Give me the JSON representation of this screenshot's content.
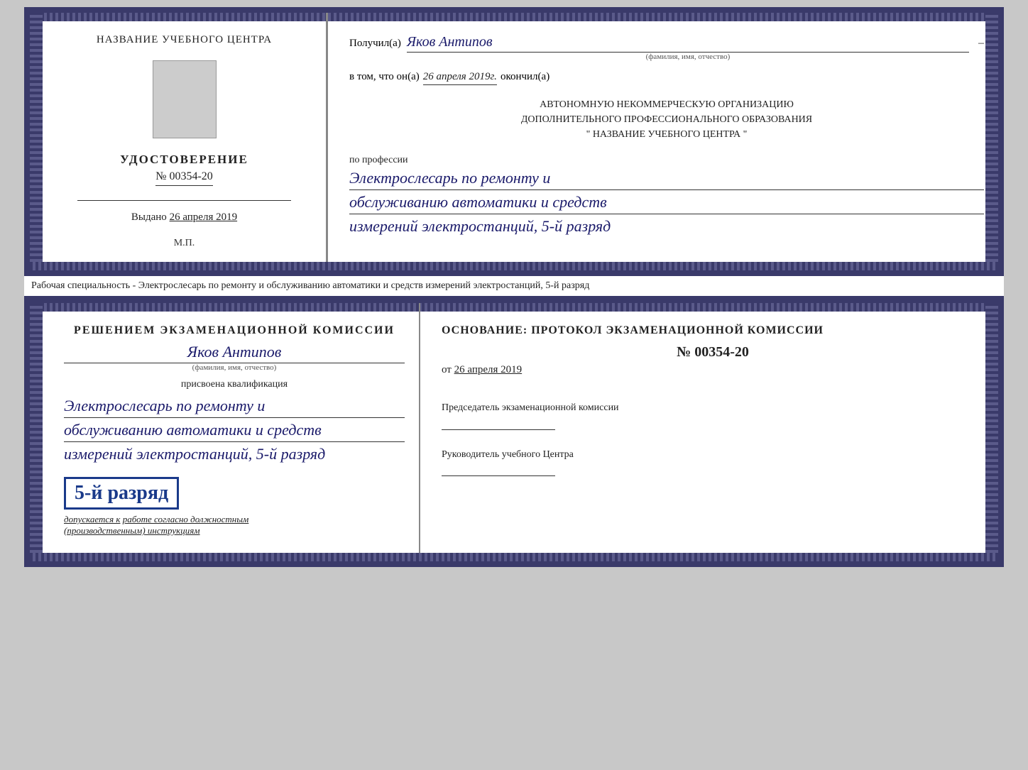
{
  "topCert": {
    "left": {
      "orgName": "НАЗВАНИЕ УЧЕБНОГО ЦЕНТРА",
      "certTitle": "УДОСТОВЕРЕНИЕ",
      "certNumber": "№ 00354-20",
      "issuedLabel": "Выдано",
      "issuedDate": "26 апреля 2019",
      "stamp": "М.П."
    },
    "right": {
      "receivedLabel": "Получил(а)",
      "recipientName": "Яков Антипов",
      "recipientSublabel": "(фамилия, имя, отчество)",
      "certifyLabel": "в том, что он(а)",
      "certifyDate": "26 апреля 2019г.",
      "finishedLabel": "окончил(а)",
      "orgFullLine1": "АВТОНОМНУЮ НЕКОММЕРЧЕСКУЮ ОРГАНИЗАЦИЮ",
      "orgFullLine2": "ДОПОЛНИТЕЛЬНОГО ПРОФЕССИОНАЛЬНОГО ОБРАЗОВАНИЯ",
      "orgFullLine3": "\"  НАЗВАНИЕ УЧЕБНОГО ЦЕНТРА  \"",
      "professionLabel": "по профессии",
      "professionLine1": "Электрослесарь по ремонту и",
      "professionLine2": "обслуживанию автоматики и средств",
      "professionLine3": "измерений электростанций, 5-й разряд"
    }
  },
  "specialtyText": "Рабочая специальность - Электрослесарь по ремонту и обслуживанию автоматики и средств\nизмерений электростанций, 5-й разряд",
  "bottomCert": {
    "left": {
      "decisionLabel": "Решением экзаменационной комиссии",
      "personName": "Яков Антипов",
      "personSublabel": "(фамилия, имя, отчество)",
      "assignedLabel": "присвоена квалификация",
      "qualLine1": "Электрослесарь по ремонту и",
      "qualLine2": "обслуживанию автоматики и средств",
      "qualLine3": "измерений электростанций, 5-й разряд",
      "rankBadge": "5-й разряд",
      "allowedText": "допускается к",
      "allowedUnderline": "работе согласно должностным",
      "allowedItalic": "(производственным) инструкциям"
    },
    "right": {
      "basisLabel": "Основание: протокол экзаменационной комиссии",
      "protocolNumber": "№ 00354-20",
      "protocolDatePrefix": "от",
      "protocolDate": "26 апреля 2019",
      "chairmanLabel": "Председатель экзаменационной\nкомиссии",
      "headLabel": "Руководитель учебного\nЦентра"
    }
  }
}
